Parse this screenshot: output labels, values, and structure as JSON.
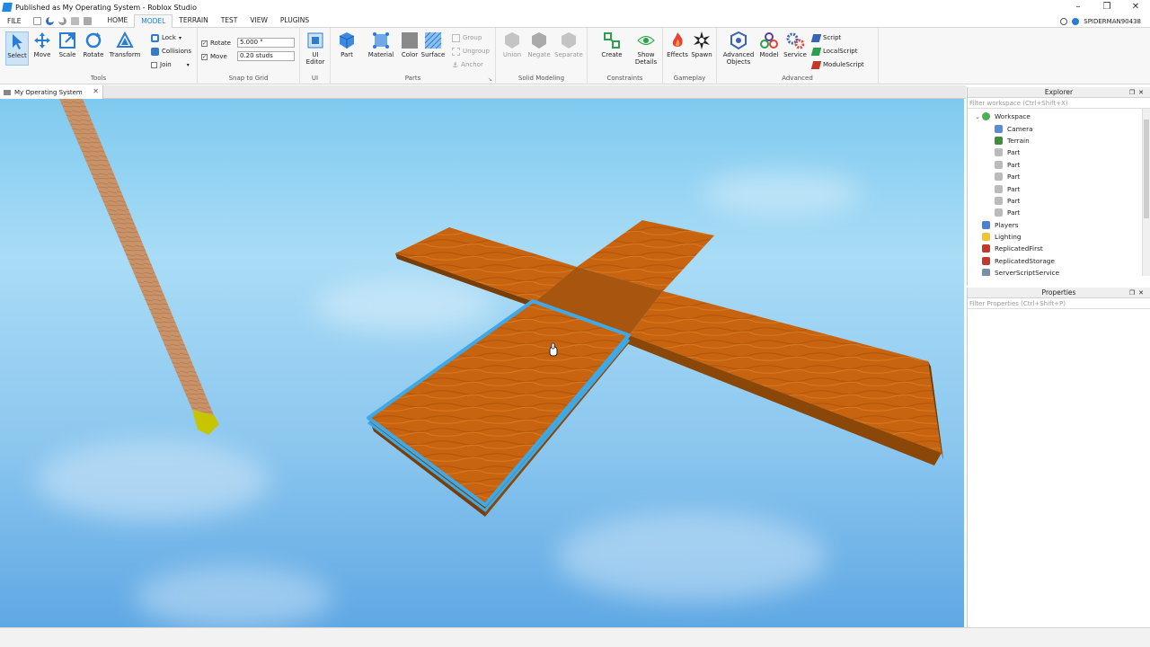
{
  "window": {
    "title": "Published as My Operating System - Roblox Studio",
    "controls": [
      "–",
      "❐",
      "✕"
    ]
  },
  "menu": {
    "file": "FILE",
    "tabs": [
      "HOME",
      "MODEL",
      "TERRAIN",
      "TEST",
      "VIEW",
      "PLUGINS"
    ],
    "active_tab": "MODEL",
    "username": "SPIDERMAN90438"
  },
  "ribbon": {
    "tools": {
      "label": "Tools",
      "buttons": [
        "Select",
        "Move",
        "Scale",
        "Rotate",
        "Transform"
      ],
      "lock": "Lock",
      "collisions": "Collisions",
      "join": "Join"
    },
    "snap": {
      "label": "Snap to Grid",
      "rotate_label": "Rotate",
      "rotate_value": "5.000 °",
      "move_label": "Move",
      "move_value": "0.20 studs"
    },
    "ui": {
      "label": "UI",
      "editor": "UI Editor"
    },
    "parts": {
      "label": "Parts",
      "buttons": [
        "Part",
        "Material",
        "Color",
        "Surface"
      ],
      "group": "Group",
      "ungroup": "Ungroup",
      "anchor": "Anchor"
    },
    "solid": {
      "label": "Solid Modeling",
      "buttons": [
        "Union",
        "Negate",
        "Separate"
      ]
    },
    "constraints": {
      "label": "Constraints",
      "buttons": [
        "Create",
        "Show Details"
      ]
    },
    "gameplay": {
      "label": "Gameplay",
      "buttons": [
        "Effects",
        "Spawn"
      ]
    },
    "advanced": {
      "label": "Advanced",
      "buttons": [
        "Advanced Objects",
        "Model",
        "Service"
      ],
      "scripts": [
        "Script",
        "LocalScript",
        "ModuleScript"
      ]
    }
  },
  "document": {
    "tab": "My Operating System"
  },
  "explorer": {
    "title": "Explorer",
    "filter_placeholder": "Filter workspace (Ctrl+Shift+X)",
    "items": [
      {
        "label": "Workspace",
        "level": 0,
        "icon": "globe-icon",
        "color": "#4caf50"
      },
      {
        "label": "Camera",
        "level": 1,
        "icon": "camera-icon",
        "color": "#5b8bd0"
      },
      {
        "label": "Terrain",
        "level": 1,
        "icon": "terrain-icon",
        "color": "#3e8e3e"
      },
      {
        "label": "Part",
        "level": 1,
        "icon": "part-icon",
        "color": "#bbbbbb"
      },
      {
        "label": "Part",
        "level": 1,
        "icon": "part-icon",
        "color": "#bbbbbb"
      },
      {
        "label": "Part",
        "level": 1,
        "icon": "part-icon",
        "color": "#bbbbbb"
      },
      {
        "label": "Part",
        "level": 1,
        "icon": "part-icon",
        "color": "#bbbbbb"
      },
      {
        "label": "Part",
        "level": 1,
        "icon": "part-icon",
        "color": "#bbbbbb"
      },
      {
        "label": "Part",
        "level": 1,
        "icon": "part-icon",
        "color": "#bbbbbb"
      },
      {
        "label": "Players",
        "level": 0,
        "icon": "players-icon",
        "color": "#4a7fd6"
      },
      {
        "label": "Lighting",
        "level": 0,
        "icon": "lightbulb-icon",
        "color": "#f4c430"
      },
      {
        "label": "ReplicatedFirst",
        "level": 0,
        "icon": "replicated-first-icon",
        "color": "#c0392b"
      },
      {
        "label": "ReplicatedStorage",
        "level": 0,
        "icon": "replicated-storage-icon",
        "color": "#c0392b"
      },
      {
        "label": "ServerScriptService",
        "level": 0,
        "icon": "server-script-service-icon",
        "color": "#7a8ea8"
      }
    ]
  },
  "properties": {
    "title": "Properties",
    "filter_placeholder": "Filter Properties (Ctrl+Shift+P)"
  },
  "colors": {
    "accent": "#2b7cd3",
    "wood": "#c8640f",
    "selection": "#3fa9e6"
  }
}
